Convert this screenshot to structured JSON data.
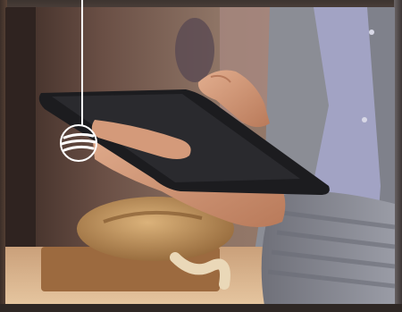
{
  "scene": {
    "description_icon": "hand-holding-tablet-photo",
    "colors": {
      "background": "#2b2522",
      "wall": "#7a6558",
      "tablet": "#1c1c1e",
      "skin": "#d9a283",
      "sweater": "#8c8f98",
      "shirt": "#9d9fc2",
      "bread": "#c99a5e"
    }
  },
  "ornament": {
    "icon": "striped-circle-badge-icon",
    "color": "#ffffff"
  }
}
